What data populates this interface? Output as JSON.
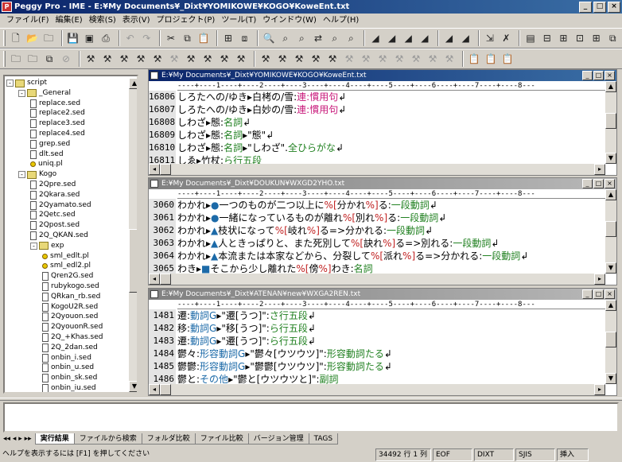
{
  "window": {
    "title": "Peggy Pro - IME - E:¥My Documents¥_Dixt¥YOMIKOWE¥KOGO¥KoweEnt.txt",
    "app_icon": "P"
  },
  "menu": [
    "ファイル(F)",
    "編集(E)",
    "検索(S)",
    "表示(V)",
    "プロジェクト(P)",
    "ツール(T)",
    "ウインドウ(W)",
    "ヘルプ(H)"
  ],
  "tree": {
    "nodes": [
      {
        "label": "script",
        "type": "folder",
        "level": 0,
        "expander": "-"
      },
      {
        "label": "_General",
        "type": "folder",
        "level": 1,
        "expander": "-"
      },
      {
        "label": "replace.sed",
        "type": "file",
        "level": 2
      },
      {
        "label": "replace2.sed",
        "type": "file",
        "level": 2
      },
      {
        "label": "replace3.sed",
        "type": "file",
        "level": 2
      },
      {
        "label": "replace4.sed",
        "type": "file",
        "level": 2
      },
      {
        "label": "grep.sed",
        "type": "file",
        "level": 2
      },
      {
        "label": "dlt.sed",
        "type": "file",
        "level": 2
      },
      {
        "label": "uniq.pl",
        "type": "pl",
        "level": 2
      },
      {
        "label": "Kogo",
        "type": "folder",
        "level": 1,
        "expander": "-"
      },
      {
        "label": "2Qpre.sed",
        "type": "file",
        "level": 2
      },
      {
        "label": "2Qkara.sed",
        "type": "file",
        "level": 2
      },
      {
        "label": "2Qyamato.sed",
        "type": "file",
        "level": 2
      },
      {
        "label": "2Qetc.sed",
        "type": "file",
        "level": 2
      },
      {
        "label": "2Qpost.sed",
        "type": "file",
        "level": 2
      },
      {
        "label": "2Q_QKAN.sed",
        "type": "file",
        "level": 2
      },
      {
        "label": "exp",
        "type": "folder",
        "level": 2,
        "expander": "-"
      },
      {
        "label": "sml_edlt.pl",
        "type": "pl",
        "level": 3
      },
      {
        "label": "sml_edl2.pl",
        "type": "pl",
        "level": 3
      },
      {
        "label": "Qren2G.sed",
        "type": "file",
        "level": 3
      },
      {
        "label": "rubykogo.sed",
        "type": "file",
        "level": 3
      },
      {
        "label": "QRkan_rb.sed",
        "type": "file",
        "level": 3
      },
      {
        "label": "KogoU2R.sed",
        "type": "file",
        "level": 3
      },
      {
        "label": "2Qyouon.sed",
        "type": "file",
        "level": 3
      },
      {
        "label": "2QyouonR.sed",
        "type": "file",
        "level": 3
      },
      {
        "label": "2Q_+Khas.sed",
        "type": "file",
        "level": 3
      },
      {
        "label": "2Q_2dan.sed",
        "type": "file",
        "level": 3
      },
      {
        "label": "onbin_i.sed",
        "type": "file",
        "level": 3
      },
      {
        "label": "onbin_u.sed",
        "type": "file",
        "level": 3
      },
      {
        "label": "onbin_sk.sed",
        "type": "file",
        "level": 3
      },
      {
        "label": "onbin_iu.sed",
        "type": "file",
        "level": 3
      }
    ]
  },
  "ruler": "----+----1----+----2----+----3----+----4----+----5----+----6----+----7----+----8---",
  "editors": [
    {
      "title": "E:¥My Documents¥_Dixt¥YOMIKOWE¥KOGO¥KoweEnt.txt",
      "active": true,
      "lines": [
        {
          "num": "16806",
          "segs": [
            [
              "しろたへの/ゆき",
              ""
            ],
            [
              "▸",
              ""
            ],
            [
              "白栲の/雪",
              ""
            ],
            [
              ":",
              ""
            ],
            [
              "連:慣用句",
              ""
            ],
            [
              "↲",
              ""
            ]
          ]
        },
        {
          "num": "16807",
          "segs": [
            [
              "しろたへの/ゆき",
              ""
            ],
            [
              "▸",
              ""
            ],
            [
              "白妙の/雪",
              ""
            ],
            [
              ":",
              ""
            ],
            [
              "連:慣用句",
              ""
            ],
            [
              "↲",
              ""
            ]
          ]
        },
        {
          "num": "16808",
          "segs": [
            [
              "しわざ",
              ""
            ],
            [
              "▸",
              ""
            ],
            [
              "態:",
              ""
            ],
            [
              "名詞",
              ""
            ],
            [
              "↲",
              ""
            ]
          ]
        },
        {
          "num": "16809",
          "segs": [
            [
              "しわざ",
              ""
            ],
            [
              "▸",
              ""
            ],
            [
              "態:",
              ""
            ],
            [
              "名詞",
              ""
            ],
            [
              "▸\"態\"",
              ""
            ],
            [
              "↲",
              ""
            ]
          ]
        },
        {
          "num": "16810",
          "segs": [
            [
              "しわざ",
              ""
            ],
            [
              "▸",
              ""
            ],
            [
              "態:",
              ""
            ],
            [
              "名詞",
              ""
            ],
            [
              "▸\"しわざ\".",
              ""
            ],
            [
              "全ひらがな",
              ""
            ],
            [
              "↲",
              ""
            ]
          ]
        },
        {
          "num": "16811",
          "segs": [
            [
              "しゑ",
              ""
            ],
            [
              "▸",
              ""
            ],
            [
              "竹杖:",
              ""
            ],
            [
              "ら行五段",
              ""
            ]
          ]
        }
      ]
    },
    {
      "title": "E:¥My Documents¥_Dixt¥DOUKUN¥WXGD2YHO.txt",
      "active": false,
      "lines": [
        {
          "num": "3060",
          "segs": [
            [
              "わかれ",
              ""
            ],
            [
              "▸",
              ""
            ],
            [
              "●",
              ""
            ],
            [
              "一つのものが二つ以上に",
              ""
            ],
            [
              "%[",
              ""
            ],
            [
              "分かれ",
              ""
            ],
            [
              "%]",
              ""
            ],
            [
              "る:",
              ""
            ],
            [
              "一段動詞",
              ""
            ],
            [
              "↲",
              ""
            ]
          ]
        },
        {
          "num": "3061",
          "segs": [
            [
              "わかれ",
              ""
            ],
            [
              "▸",
              ""
            ],
            [
              "●",
              ""
            ],
            [
              "一緒になっているものが離れ",
              ""
            ],
            [
              "%[",
              ""
            ],
            [
              "別れ",
              ""
            ],
            [
              "%]",
              ""
            ],
            [
              "る:",
              ""
            ],
            [
              "一段動詞",
              ""
            ],
            [
              "↲",
              ""
            ]
          ]
        },
        {
          "num": "3062",
          "segs": [
            [
              "わかれ",
              ""
            ],
            [
              "▸",
              ""
            ],
            [
              "▲",
              ""
            ],
            [
              "枝状になって",
              ""
            ],
            [
              "%[",
              ""
            ],
            [
              "岐れ",
              ""
            ],
            [
              "%]",
              ""
            ],
            [
              "る=>分かれる:",
              ""
            ],
            [
              "一段動詞",
              ""
            ],
            [
              "↲",
              ""
            ]
          ]
        },
        {
          "num": "3063",
          "segs": [
            [
              "わかれ",
              ""
            ],
            [
              "▸",
              ""
            ],
            [
              "▲",
              ""
            ],
            [
              "人ときっぱりと、また死別して",
              ""
            ],
            [
              "%[",
              ""
            ],
            [
              "訣れ",
              ""
            ],
            [
              "%]",
              ""
            ],
            [
              "る=>別れる:",
              ""
            ],
            [
              "一段動詞",
              ""
            ],
            [
              "↲",
              ""
            ]
          ]
        },
        {
          "num": "3064",
          "segs": [
            [
              "わかれ",
              ""
            ],
            [
              "▸",
              ""
            ],
            [
              "▲",
              ""
            ],
            [
              "本流または本家などから、分裂して",
              ""
            ],
            [
              "%[",
              ""
            ],
            [
              "派れ",
              ""
            ],
            [
              "%]",
              ""
            ],
            [
              "る=>分かれる:",
              ""
            ],
            [
              "一段動詞",
              ""
            ],
            [
              "↲",
              ""
            ]
          ]
        },
        {
          "num": "3065",
          "segs": [
            [
              "わき",
              ""
            ],
            [
              "▸",
              ""
            ],
            [
              "■",
              ""
            ],
            [
              "そこから少し離れた",
              ""
            ],
            [
              "%[",
              ""
            ],
            [
              "傍",
              ""
            ],
            [
              "%]",
              ""
            ],
            [
              "わき:",
              ""
            ],
            [
              "名詞",
              ""
            ]
          ]
        }
      ]
    },
    {
      "title": "E:¥My Documents¥_Dixt¥ATENAN¥new¥WXGA2REN.txt",
      "active": false,
      "lines": [
        {
          "num": "1481",
          "segs": [
            [
              "遷:",
              ""
            ],
            [
              "動詞G",
              ""
            ],
            [
              "▸",
              ""
            ],
            [
              "\"遷[うつ]\":",
              ""
            ],
            [
              "さ行五段",
              ""
            ],
            [
              "↲",
              ""
            ]
          ]
        },
        {
          "num": "1482",
          "segs": [
            [
              "移:",
              ""
            ],
            [
              "動詞G",
              ""
            ],
            [
              "▸",
              ""
            ],
            [
              "\"移[うつ]\":",
              ""
            ],
            [
              "ら行五段",
              ""
            ],
            [
              "↲",
              ""
            ]
          ]
        },
        {
          "num": "1483",
          "segs": [
            [
              "遷:",
              ""
            ],
            [
              "動詞G",
              ""
            ],
            [
              "▸",
              ""
            ],
            [
              "\"遷[うつ]\":",
              ""
            ],
            [
              "ら行五段",
              ""
            ],
            [
              "↲",
              ""
            ]
          ]
        },
        {
          "num": "1484",
          "segs": [
            [
              "鬱々:",
              ""
            ],
            [
              "形容動詞G",
              ""
            ],
            [
              "▸",
              ""
            ],
            [
              "\"鬱々[ウツウツ]\":",
              ""
            ],
            [
              "形容動詞たる",
              ""
            ],
            [
              "↲",
              ""
            ]
          ]
        },
        {
          "num": "1485",
          "segs": [
            [
              "鬱鬱:",
              ""
            ],
            [
              "形容動詞G",
              ""
            ],
            [
              "▸",
              ""
            ],
            [
              "\"鬱鬱[ウツウツ]\":",
              ""
            ],
            [
              "形容動詞たる",
              ""
            ],
            [
              "↲",
              ""
            ]
          ]
        },
        {
          "num": "1486",
          "segs": [
            [
              "鬱と:",
              ""
            ],
            [
              "その他",
              ""
            ],
            [
              "▸",
              ""
            ],
            [
              "\"鬱と[ウツウツと]\":",
              ""
            ],
            [
              "副詞",
              ""
            ]
          ]
        }
      ]
    }
  ],
  "tabs": [
    "実行結果",
    "ファイルから検索",
    "フォルダ比較",
    "ファイル比較",
    "バージョン管理",
    "TAGS"
  ],
  "status": {
    "help": "ヘルプを表示するには [F1] を押してください",
    "position": "34492 行 1 列",
    "eof": "EOF",
    "dixt": "DIXT",
    "encoding": "SJIS",
    "mode": "挿入"
  }
}
